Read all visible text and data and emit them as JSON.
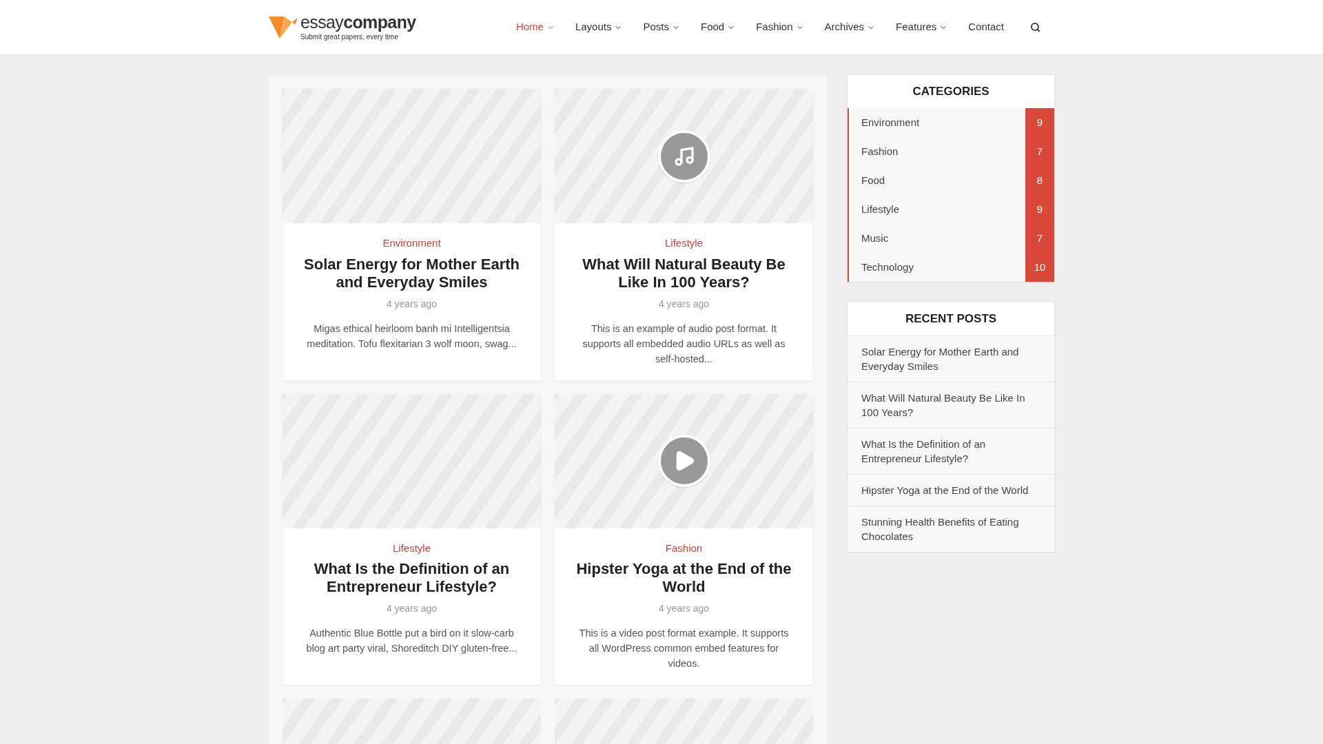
{
  "logo": {
    "name_light": "essay",
    "name_bold": "company",
    "tagline": "Submit great papers, every time"
  },
  "nav": [
    {
      "label": "Home",
      "selected": true,
      "dropdown": true
    },
    {
      "label": "Layouts",
      "selected": false,
      "dropdown": true
    },
    {
      "label": "Posts",
      "selected": false,
      "dropdown": true
    },
    {
      "label": "Food",
      "selected": false,
      "dropdown": true
    },
    {
      "label": "Fashion",
      "selected": false,
      "dropdown": true
    },
    {
      "label": "Archives",
      "selected": false,
      "dropdown": true
    },
    {
      "label": "Features",
      "selected": false,
      "dropdown": true
    },
    {
      "label": "Contact",
      "selected": false,
      "dropdown": false
    }
  ],
  "posts": [
    {
      "kind": "standard",
      "category": "Environment",
      "title": "Solar Energy for Mother Earth and Everyday Smiles",
      "date": "4 years ago",
      "excerpt": "Migas ethical heirloom banh mi Intelligentsia meditation. Tofu flexitarian 3 wolf moon, swag..."
    },
    {
      "kind": "audio",
      "category": "Lifestyle",
      "title": "What Will Natural Beauty Be Like In 100 Years?",
      "date": "4 years ago",
      "excerpt": "This is an example of audio post format. It supports all embedded audio URLs as well as self-hosted..."
    },
    {
      "kind": "standard",
      "category": "Lifestyle",
      "title": "What Is the Definition of an Entrepreneur Lifestyle?",
      "date": "4 years ago",
      "excerpt": "Authentic Blue Bottle put a bird on it slow-carb blog art party viral, Shoreditch DIY gluten-free..."
    },
    {
      "kind": "video",
      "category": "Fashion",
      "title": "Hipster Yoga at the End of the World",
      "date": "4 years ago",
      "excerpt": "This is a video post format example. It supports all WordPress common embed features for videos."
    }
  ],
  "categories": {
    "title": "CATEGORIES",
    "items": [
      {
        "name": "Environment",
        "count": "9"
      },
      {
        "name": "Fashion",
        "count": "7"
      },
      {
        "name": "Food",
        "count": "8"
      },
      {
        "name": "Lifestyle",
        "count": "9"
      },
      {
        "name": "Music",
        "count": "7"
      },
      {
        "name": "Technology",
        "count": "10"
      }
    ]
  },
  "recent_posts": {
    "title": "RECENT POSTS",
    "items": [
      "Solar Energy for Mother Earth and Everyday Smiles",
      "What Will Natural Beauty Be Like In 100 Years?",
      "What Is the Definition of an Entrepreneur Lifestyle?",
      "Hipster Yoga at the End of the World",
      "Stunning Health Benefits of Eating Chocolates"
    ]
  }
}
